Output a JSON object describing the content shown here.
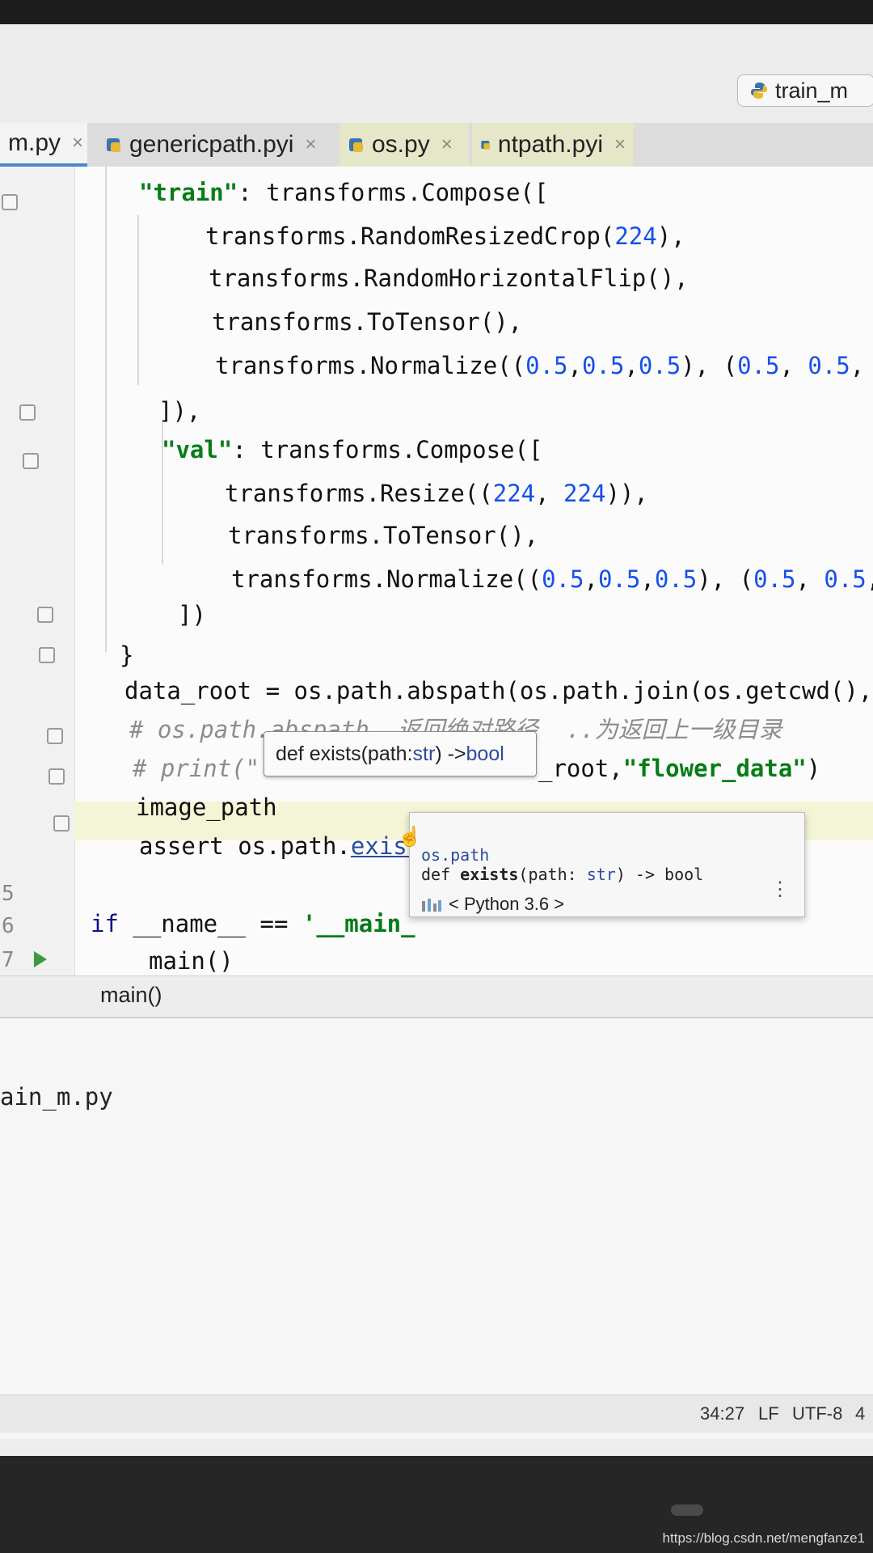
{
  "toolbar": {
    "run_config": "train_m"
  },
  "tabs": [
    {
      "label": "m.py",
      "close": "×"
    },
    {
      "label": "genericpath.pyi",
      "close": "×"
    },
    {
      "label": "os.py",
      "close": "×"
    },
    {
      "label": "ntpath.pyi",
      "close": "×"
    }
  ],
  "code": [
    "\"train\": transforms.Compose([",
    "transforms.RandomResizedCrop(224),",
    "transforms.RandomHorizontalFlip(),",
    "transforms.ToTensor(),",
    "transforms.Normalize((0.5,0.5,0.5), (0.5, 0.5,",
    "]),",
    "\"val\": transforms.Compose([",
    "transforms.Resize((224, 224)),",
    "transforms.ToTensor(),",
    "transforms.Normalize((0.5,0.5,0.5), (0.5, 0.5,",
    "])",
    "}",
    "data_root = os.path.abspath(os.path.join(os.getcwd(), \"",
    "# os.path.abspath  返回绝对路径  ..为返回上一级目录",
    "# print(\"",
    "_root,\"flower_data\")",
    "image_path",
    "assert os.path.exists(|)",
    "if __name__ == '__main_",
    "main()"
  ],
  "line_numbers": [
    "5",
    "6",
    "7"
  ],
  "param_hint": {
    "prefix": "def exists(path: ",
    "type": "str",
    "middle": ") -> ",
    "ret": "bool"
  },
  "doc_popup": {
    "module": "os.path",
    "signature_prefix": "def ",
    "signature_name": "exists",
    "signature_args": "(path: ",
    "signature_type": "str",
    "signature_ret": ") -> bool",
    "sdk": "< Python 3.6 >",
    "menu": "⋮"
  },
  "breadcrumb": "main()",
  "run_panel": {
    "file": "ain_m.py"
  },
  "status": {
    "position": "34:27",
    "line_sep": "LF",
    "encoding": "UTF-8",
    "indent": "4"
  },
  "watermark": "https://blog.csdn.net/mengfanze1",
  "colors": {
    "keyword": "#10108a",
    "string": "#067d17",
    "number": "#1750eb",
    "comment": "#8c8c8c"
  }
}
